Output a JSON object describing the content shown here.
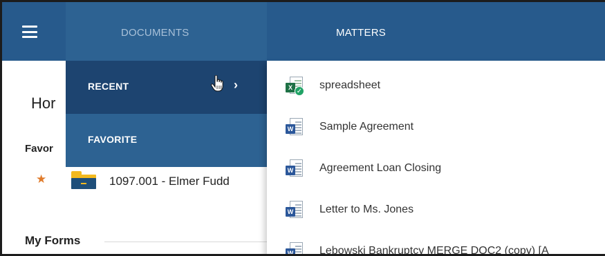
{
  "nav": {
    "documents_label": "DOCUMENTS",
    "matters_label": "MATTERS"
  },
  "home": {
    "title": "Hor",
    "favorites_heading": "Favor",
    "favorite_matter": "1097.001 - Elmer Fudd",
    "my_forms_heading": "My Forms"
  },
  "documents_menu": {
    "items": [
      {
        "label": "RECENT",
        "has_submenu": true,
        "active": true
      },
      {
        "label": "FAVORITE",
        "has_submenu": false,
        "active": false
      }
    ]
  },
  "recent_documents": [
    {
      "name": "spreadsheet",
      "type": "excel-icon"
    },
    {
      "name": "Sample Agreement",
      "type": "word-icon"
    },
    {
      "name": "Agreement Loan Closing",
      "type": "word-icon"
    },
    {
      "name": "Letter to Ms. Jones",
      "type": "word-icon"
    },
    {
      "name": "Lebowski Bankruptcy MERGE DOC2 (copy) [A",
      "type": "word-icon"
    }
  ],
  "colors": {
    "nav_bar": "#275a8c",
    "documents_tab": "#2d6292",
    "recent_active": "#1d4470",
    "favorite_star": "#e07b2a"
  }
}
